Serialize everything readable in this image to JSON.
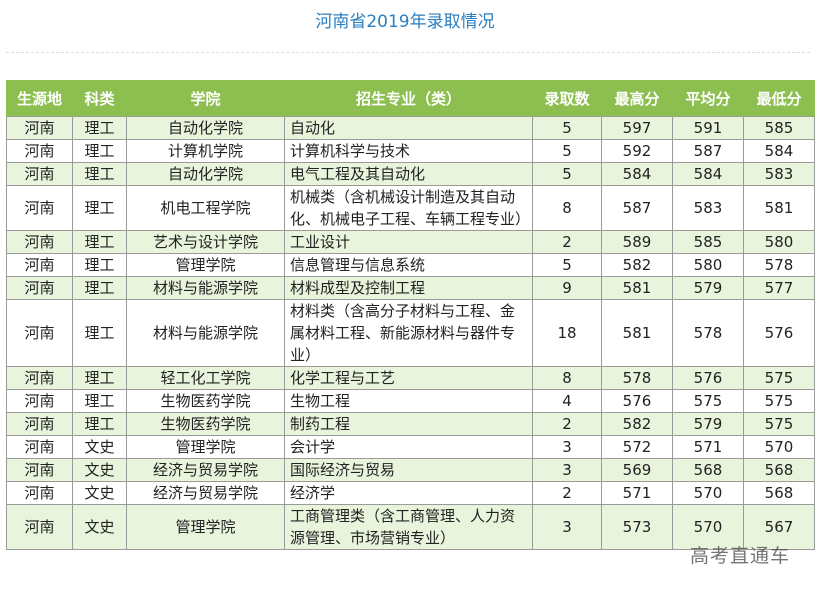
{
  "page": {
    "title": "河南省2019年录取情况"
  },
  "table": {
    "headers": [
      "生源地",
      "科类",
      "学院",
      "招生专业（类）",
      "录取数",
      "最高分",
      "平均分",
      "最低分"
    ],
    "rows": [
      {
        "origin": "河南",
        "category": "理工",
        "college": "自动化学院",
        "major": "自动化",
        "admitted": "5",
        "max": "597",
        "avg": "591",
        "min": "585"
      },
      {
        "origin": "河南",
        "category": "理工",
        "college": "计算机学院",
        "major": "计算机科学与技术",
        "admitted": "5",
        "max": "592",
        "avg": "587",
        "min": "584"
      },
      {
        "origin": "河南",
        "category": "理工",
        "college": "自动化学院",
        "major": "电气工程及其自动化",
        "admitted": "5",
        "max": "584",
        "avg": "584",
        "min": "583"
      },
      {
        "origin": "河南",
        "category": "理工",
        "college": "机电工程学院",
        "major": "机械类（含机械设计制造及其自动化、机械电子工程、车辆工程专业）",
        "admitted": "8",
        "max": "587",
        "avg": "583",
        "min": "581"
      },
      {
        "origin": "河南",
        "category": "理工",
        "college": "艺术与设计学院",
        "major": "工业设计",
        "admitted": "2",
        "max": "589",
        "avg": "585",
        "min": "580"
      },
      {
        "origin": "河南",
        "category": "理工",
        "college": "管理学院",
        "major": "信息管理与信息系统",
        "admitted": "5",
        "max": "582",
        "avg": "580",
        "min": "578"
      },
      {
        "origin": "河南",
        "category": "理工",
        "college": "材料与能源学院",
        "major": "材料成型及控制工程",
        "admitted": "9",
        "max": "581",
        "avg": "579",
        "min": "577"
      },
      {
        "origin": "河南",
        "category": "理工",
        "college": "材料与能源学院",
        "major": "材料类（含高分子材料与工程、金属材料工程、新能源材料与器件专业）",
        "admitted": "18",
        "max": "581",
        "avg": "578",
        "min": "576"
      },
      {
        "origin": "河南",
        "category": "理工",
        "college": "轻工化工学院",
        "major": "化学工程与工艺",
        "admitted": "8",
        "max": "578",
        "avg": "576",
        "min": "575"
      },
      {
        "origin": "河南",
        "category": "理工",
        "college": "生物医药学院",
        "major": "生物工程",
        "admitted": "4",
        "max": "576",
        "avg": "575",
        "min": "575"
      },
      {
        "origin": "河南",
        "category": "理工",
        "college": "生物医药学院",
        "major": "制药工程",
        "admitted": "2",
        "max": "582",
        "avg": "579",
        "min": "575"
      },
      {
        "origin": "河南",
        "category": "文史",
        "college": "管理学院",
        "major": "会计学",
        "admitted": "3",
        "max": "572",
        "avg": "571",
        "min": "570"
      },
      {
        "origin": "河南",
        "category": "文史",
        "college": "经济与贸易学院",
        "major": "国际经济与贸易",
        "admitted": "3",
        "max": "569",
        "avg": "568",
        "min": "568"
      },
      {
        "origin": "河南",
        "category": "文史",
        "college": "经济与贸易学院",
        "major": "经济学",
        "admitted": "2",
        "max": "571",
        "avg": "570",
        "min": "568"
      },
      {
        "origin": "河南",
        "category": "文史",
        "college": "管理学院",
        "major": "工商管理类（含工商管理、人力资源管理、市场营销专业）",
        "admitted": "3",
        "max": "573",
        "avg": "570",
        "min": "567"
      }
    ]
  },
  "watermark": {
    "text": "高考直通车"
  }
}
